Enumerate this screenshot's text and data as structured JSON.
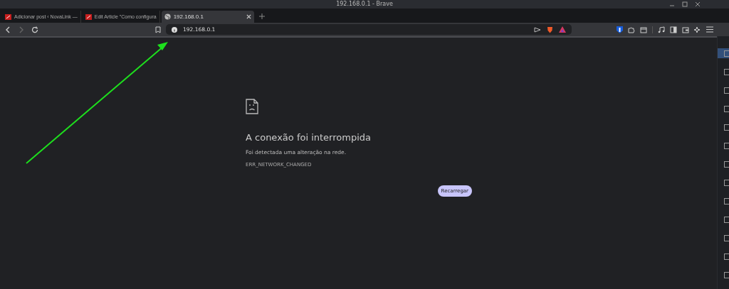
{
  "window": {
    "title": "192.168.0.1 - Brave"
  },
  "tabs": [
    {
      "label": "Adicionar post ‹ NovaLink —",
      "selected": false,
      "kind": "site"
    },
    {
      "label": "Edit Article \"Como configura",
      "selected": false,
      "kind": "site"
    },
    {
      "label": "192.168.0.1",
      "selected": true,
      "kind": "globe"
    }
  ],
  "address_bar": {
    "value": "192.168.0.1"
  },
  "error_page": {
    "title": "A conexão foi interrompida",
    "message": "Foi detectada uma alteração na rede.",
    "code": "ERR_NETWORK_CHANGED",
    "button": "Recarregar"
  },
  "side_strip": {
    "items": [
      {
        "selected": true
      },
      {
        "selected": false
      },
      {
        "selected": false
      },
      {
        "selected": false
      },
      {
        "selected": false
      },
      {
        "selected": false
      },
      {
        "selected": false
      },
      {
        "selected": false
      },
      {
        "selected": false
      },
      {
        "selected": false
      },
      {
        "selected": false
      },
      {
        "selected": false
      },
      {
        "selected": false
      }
    ]
  }
}
